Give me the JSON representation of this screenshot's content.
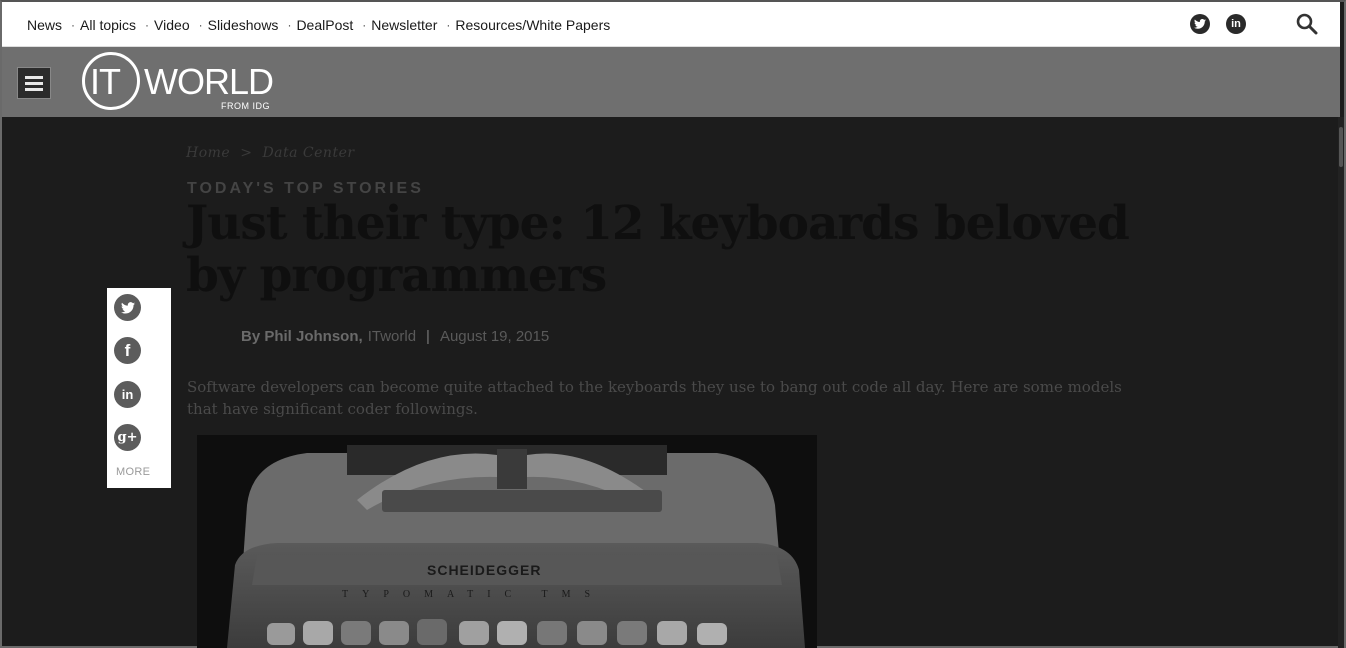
{
  "topnav": {
    "links": [
      "News",
      "All topics",
      "Video",
      "Slideshows",
      "DealPost",
      "Newsletter",
      "Resources/White Papers"
    ],
    "social_icons": [
      "twitter-icon",
      "linkedin-icon"
    ],
    "search_icon": "search-icon"
  },
  "brand": {
    "logo_it": "IT",
    "logo_world": "WORLD",
    "logo_tag": "FROM IDG",
    "menu_icon": "hamburger-menu-icon"
  },
  "breadcrumb": {
    "home": "Home",
    "separator": ">",
    "section": "Data Center"
  },
  "article": {
    "kicker": "TODAY'S TOP STORIES",
    "headline": "Just their type: 12 keyboards beloved by programmers",
    "author": "By Phil Johnson,",
    "publication": "ITworld",
    "separator": "|",
    "date": "August 19, 2015",
    "summary": "Software developers can become quite attached to the keyboards they use to bang out code all day. Here are some models that have significant coder followings."
  },
  "share": {
    "icons": [
      "twitter-icon",
      "facebook-icon",
      "linkedin-icon",
      "google-plus-icon"
    ],
    "more_label": "MORE"
  },
  "hero": {
    "brand_text": "SCHEIDEGGER",
    "model_text": "TYPOMATIC TMS"
  },
  "colors": {
    "topnav_bg": "#ffffff",
    "brandbar_bg": "#6f6f6f",
    "overlay_bg": "#1c1c1c"
  }
}
